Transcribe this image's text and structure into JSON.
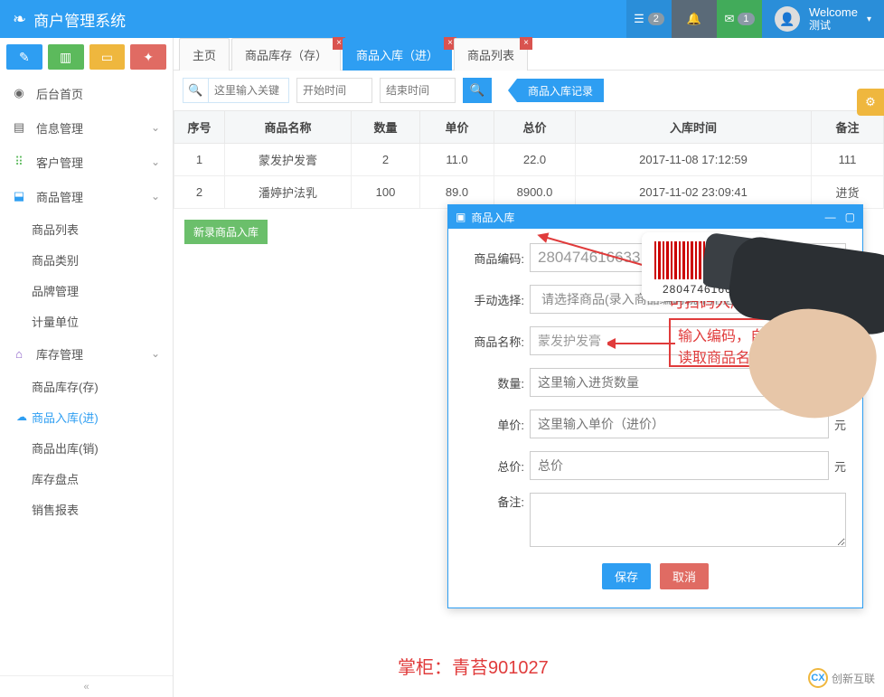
{
  "header": {
    "brand": "商户管理系统",
    "list_badge": "2",
    "mail_badge": "1",
    "welcome": "Welcome",
    "user": "测试"
  },
  "sidebar": {
    "home": "后台首页",
    "info": "信息管理",
    "cust": "客户管理",
    "prod": "商品管理",
    "prod_sub": {
      "list": "商品列表",
      "cat": "商品类别",
      "brand": "品牌管理",
      "unit": "计量单位"
    },
    "stock": "库存管理",
    "stock_sub": {
      "have": "商品库存(存)",
      "in": "商品入库(进)",
      "out": "商品出库(销)",
      "check": "库存盘点",
      "report": "销售报表"
    }
  },
  "tabs": {
    "home": "主页",
    "stock": "商品库存（存）",
    "in": "商品入库（进）",
    "list": "商品列表"
  },
  "toolbar": {
    "search_ph": "这里输入关键",
    "start_ph": "开始时间",
    "end_ph": "结束时间",
    "link": "商品入库记录"
  },
  "table": {
    "cols": {
      "idx": "序号",
      "name": "商品名称",
      "qty": "数量",
      "price": "单价",
      "total": "总价",
      "time": "入库时间",
      "remark": "备注"
    },
    "rows": [
      {
        "idx": "1",
        "name": "蒙发护发膏",
        "qty": "2",
        "price": "11.0",
        "total": "22.0",
        "time": "2017-11-08 17:12:59",
        "remark": "111"
      },
      {
        "idx": "2",
        "name": "潘婷护法乳",
        "qty": "100",
        "price": "89.0",
        "total": "8900.0",
        "time": "2017-11-02 23:09:41",
        "remark": "进货"
      }
    ]
  },
  "below": {
    "new": "新录商品入库"
  },
  "modal": {
    "title": "商品入库",
    "code_lab": "商品编码:",
    "code_val": "280474616633",
    "sel_lab": "手动选择:",
    "sel_ph": "请选择商品(录入商品编码就不用选择了)",
    "name_lab": "商品名称:",
    "name_val": "蒙发护发膏",
    "qty_lab": "数量:",
    "qty_ph": "这里输入进货数量",
    "price_lab": "单价:",
    "price_ph": "这里输入单价（进价）",
    "total_lab": "总价:",
    "total_ph": "总价",
    "unit": "元",
    "remark_lab": "备注:",
    "save": "保存",
    "cancel": "取消"
  },
  "annotations": {
    "scan": "可扫码入库",
    "auto": "输入编码，自动异步\n读取商品名称",
    "barcode": "280474616633"
  },
  "footer": "掌柜：青苔901027",
  "watermark": "创新互联"
}
